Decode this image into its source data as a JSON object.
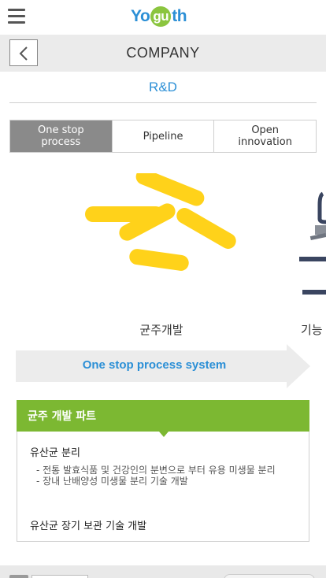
{
  "header": {
    "menu_icon": "hamburger-menu-icon",
    "logo": {
      "part1": "Yo",
      "part2": "gu",
      "part3": "th",
      "colors": {
        "blue": "#2b8fd6",
        "green": "#8bc53f"
      }
    }
  },
  "company_bar": {
    "back_icon": "chevron-left-icon",
    "title": "COMPANY"
  },
  "page": {
    "subtitle": "R&D"
  },
  "tabs": [
    {
      "label": "One stop\nprocess",
      "active": true
    },
    {
      "label": "Pipeline",
      "active": false
    },
    {
      "label": "Open\ninnovation",
      "active": false
    }
  ],
  "slider": {
    "current": {
      "caption": "균주개발",
      "icon": "strain-development-illustration"
    },
    "next": {
      "caption": "기능",
      "icon": "lab-equipment-illustration"
    },
    "banner_text": "One stop process system",
    "accent_yellow": "#ffd21a"
  },
  "card": {
    "header_title": "균주 개발 파트",
    "header_color": "#7cb832",
    "sections": [
      {
        "title": "유산균 분리",
        "bullets": [
          "- 전통 발효식품 및 건강인의 분변으로 부터 유용 미생물 분리",
          "- 장내 난배양성 미생물 분리 기술 개발"
        ]
      },
      {
        "title": "유산균 장기 보관 기술 개발",
        "bullets": []
      }
    ]
  }
}
